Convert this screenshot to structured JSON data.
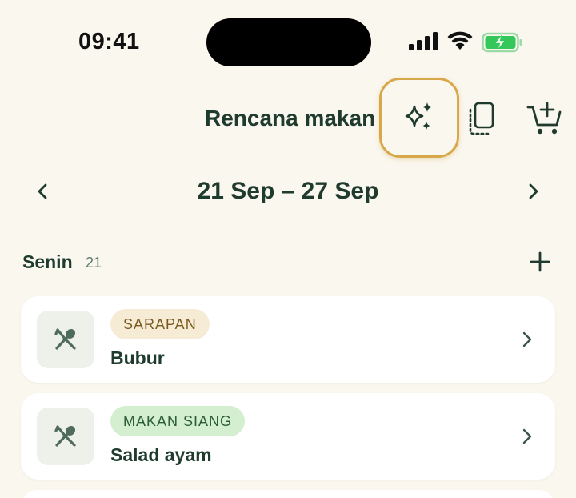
{
  "status_bar": {
    "time": "09:41"
  },
  "header": {
    "title": "Rencana makan"
  },
  "week": {
    "range": "21 Sep – 27 Sep"
  },
  "day": {
    "name": "Senin",
    "number": "21"
  },
  "meals": [
    {
      "tag": "SARAPAN",
      "name": "Bubur"
    },
    {
      "tag": "MAKAN SIANG",
      "name": "Salad ayam"
    }
  ],
  "colors": {
    "background": "#faf7ef",
    "primary_text": "#1f3b2e",
    "highlight_ring": "#d7a84a",
    "battery_green": "#34c759",
    "tag_breakfast_bg": "#f6ecd6",
    "tag_lunch_bg": "#d3efcf"
  },
  "icons": {
    "ai_suggest": "sparkles-icon",
    "copy": "copy-plan-icon",
    "cart": "add-to-cart-icon",
    "meal": "utensils-icon"
  }
}
